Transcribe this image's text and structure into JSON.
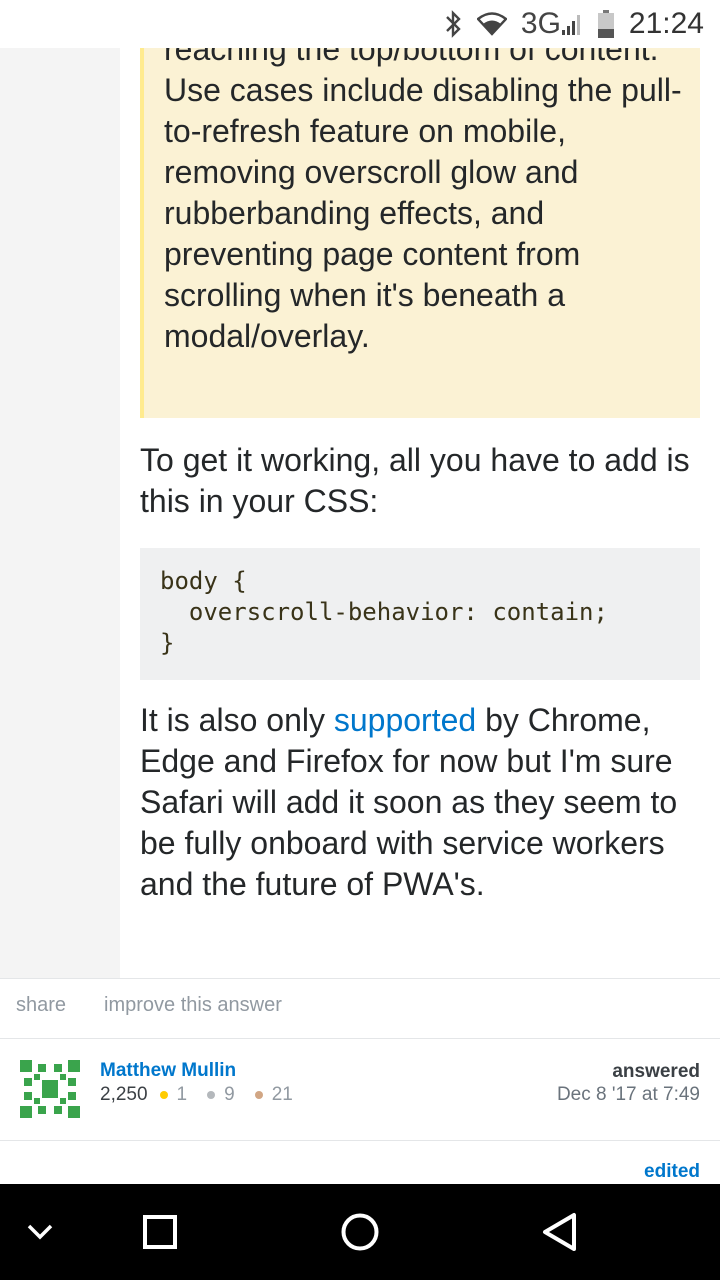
{
  "status_bar": {
    "network": "3G",
    "time": "21:24",
    "icons": [
      "bluetooth-icon",
      "wifi-icon",
      "signal-icon",
      "battery-icon"
    ]
  },
  "quote": {
    "text": "reaching the top/bottom of content. Use cases include disabling the pull-to-refresh feature on mobile, removing overscroll glow and rubberbanding effects, and preventing page content from scrolling when it's beneath a modal/overlay."
  },
  "paragraph1": "To get it working, all you have to add is this in your CSS:",
  "code_block": "body {\n  overscroll-behavior: contain;\n}",
  "paragraph2": {
    "before": "It is also only ",
    "link": "supported",
    "after": " by Chrome, Edge and Firefox for now but I'm sure Safari will add it soon as they seem to be fully onboard with service workers and the future of PWA's."
  },
  "post_actions": {
    "share": "share",
    "improve": "improve this answer"
  },
  "user": {
    "name": "Matthew Mullin",
    "reputation": "2,250",
    "gold": "1",
    "silver": "9",
    "bronze": "21"
  },
  "answered": {
    "label": "answered",
    "time": "Dec 8 '17 at 7:49"
  },
  "edited_label": "edited",
  "colors": {
    "link": "#0077cc",
    "quote_bg": "#fbf2d4",
    "quote_border": "#ffeb8e",
    "code_bg": "#eff0f1",
    "gold": "#ffcc01",
    "silver": "#b4b8bc",
    "bronze": "#d1a684"
  },
  "nav_bar": {
    "icons": [
      "hide-keyboard-icon",
      "recents-icon",
      "home-icon",
      "back-icon"
    ]
  }
}
